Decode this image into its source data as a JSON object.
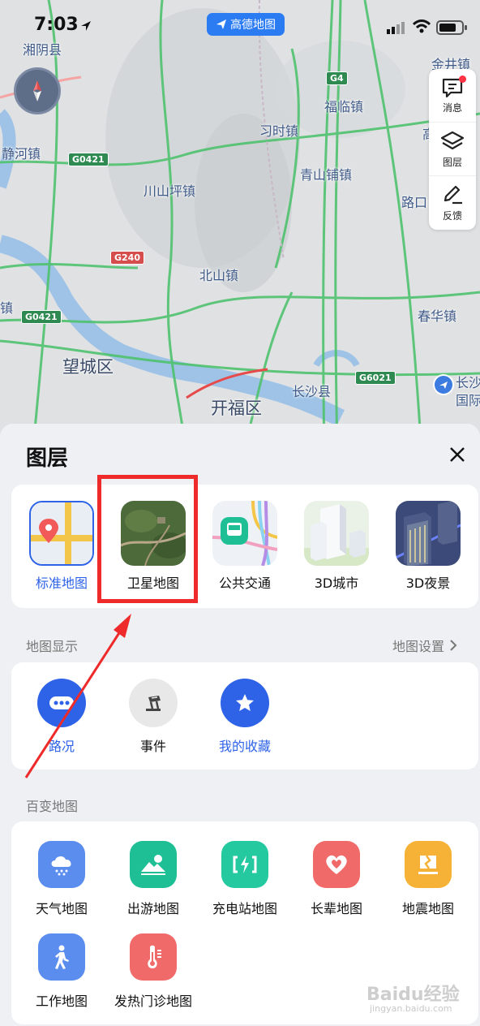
{
  "status_bar": {
    "time": "7:03"
  },
  "app_pill": {
    "label": "高德地图"
  },
  "map": {
    "places": [
      "湘阴县",
      "金井镇",
      "静河镇",
      "福临镇",
      "高",
      "川山坪镇",
      "习时镇",
      "青山铺镇",
      "路口",
      "北山镇",
      "镇",
      "春华镇",
      "望城区",
      "开福区",
      "长沙县",
      "长沙",
      "国际"
    ],
    "road_labels": [
      "G4",
      "G0421",
      "G240",
      "G0421",
      "G6021"
    ]
  },
  "right_tools": [
    {
      "label": "消息",
      "icon": "message-icon",
      "badge": true
    },
    {
      "label": "图层",
      "icon": "layers-icon"
    },
    {
      "label": "反馈",
      "icon": "feedback-pen-icon"
    }
  ],
  "panel": {
    "title": "图层",
    "layers": [
      {
        "label": "标准地图",
        "selected": true
      },
      {
        "label": "卫星地图"
      },
      {
        "label": "公共交通"
      },
      {
        "label": "3D城市"
      },
      {
        "label": "3D夜景"
      }
    ],
    "display_section": {
      "title": "地图显示",
      "settings_link": "地图设置",
      "items": [
        {
          "label": "路况",
          "color": "#2e63e8",
          "active": true
        },
        {
          "label": "事件",
          "color": "#e8e8e8"
        },
        {
          "label": "我的收藏",
          "color": "#2e63e8",
          "active": true
        }
      ]
    },
    "variety_section": {
      "title": "百变地图",
      "items": [
        {
          "label": "天气地图",
          "color": "#5b8def"
        },
        {
          "label": "出游地图",
          "color": "#1fbf95"
        },
        {
          "label": "充电站地图",
          "color": "#25c9a0"
        },
        {
          "label": "长辈地图",
          "color": "#f06a6a"
        },
        {
          "label": "地震地图",
          "color": "#f6b236"
        },
        {
          "label": "工作地图",
          "color": "#5b8def"
        },
        {
          "label": "发热门诊地图",
          "color": "#f06a6a"
        }
      ]
    }
  },
  "annotation": {
    "highlight_color": "#ee2a2a"
  },
  "watermark": {
    "text": "Baidu经验",
    "sub": "jingyan.baidu.com"
  }
}
